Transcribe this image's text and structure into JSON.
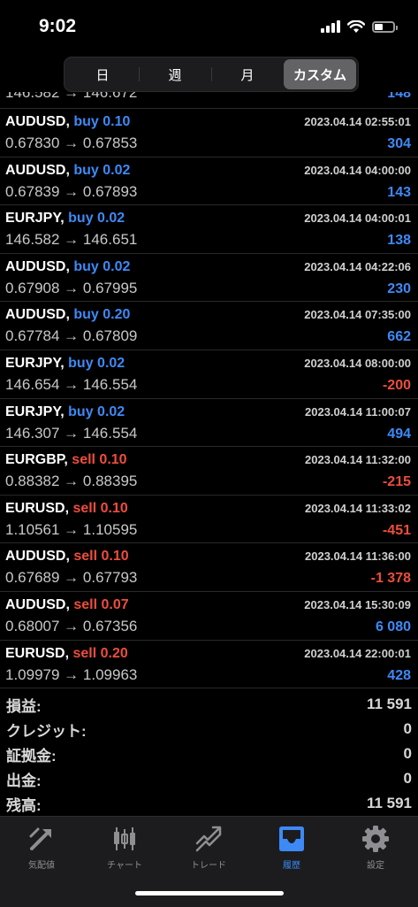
{
  "status_bar": {
    "time": "9:02"
  },
  "segments": [
    {
      "label": "日",
      "active": false
    },
    {
      "label": "週",
      "active": false
    },
    {
      "label": "月",
      "active": false
    },
    {
      "label": "カスタム",
      "active": true
    }
  ],
  "partial_row": {
    "prices": "146.582 → 146.672",
    "profit": "148"
  },
  "trades": [
    {
      "symbol": "AUDUSD,",
      "side": "buy 0.10",
      "type": "buy",
      "time": "2023.04.14 02:55:01",
      "prices": "0.67830 → 0.67853",
      "profit": "304",
      "sign": "pos"
    },
    {
      "symbol": "AUDUSD,",
      "side": "buy 0.02",
      "type": "buy",
      "time": "2023.04.14 04:00:00",
      "prices": "0.67839 → 0.67893",
      "profit": "143",
      "sign": "pos"
    },
    {
      "symbol": "EURJPY,",
      "side": "buy 0.02",
      "type": "buy",
      "time": "2023.04.14 04:00:01",
      "prices": "146.582 → 146.651",
      "profit": "138",
      "sign": "pos"
    },
    {
      "symbol": "AUDUSD,",
      "side": "buy 0.02",
      "type": "buy",
      "time": "2023.04.14 04:22:06",
      "prices": "0.67908 → 0.67995",
      "profit": "230",
      "sign": "pos"
    },
    {
      "symbol": "AUDUSD,",
      "side": "buy 0.20",
      "type": "buy",
      "time": "2023.04.14 07:35:00",
      "prices": "0.67784 → 0.67809",
      "profit": "662",
      "sign": "pos"
    },
    {
      "symbol": "EURJPY,",
      "side": "buy 0.02",
      "type": "buy",
      "time": "2023.04.14 08:00:00",
      "prices": "146.654 → 146.554",
      "profit": "-200",
      "sign": "neg"
    },
    {
      "symbol": "EURJPY,",
      "side": "buy 0.02",
      "type": "buy",
      "time": "2023.04.14 11:00:07",
      "prices": "146.307 → 146.554",
      "profit": "494",
      "sign": "pos"
    },
    {
      "symbol": "EURGBP,",
      "side": "sell 0.10",
      "type": "sell",
      "time": "2023.04.14 11:32:00",
      "prices": "0.88382 → 0.88395",
      "profit": "-215",
      "sign": "neg"
    },
    {
      "symbol": "EURUSD,",
      "side": "sell 0.10",
      "type": "sell",
      "time": "2023.04.14 11:33:02",
      "prices": "1.10561 → 1.10595",
      "profit": "-451",
      "sign": "neg"
    },
    {
      "symbol": "AUDUSD,",
      "side": "sell 0.10",
      "type": "sell",
      "time": "2023.04.14 11:36:00",
      "prices": "0.67689 → 0.67793",
      "profit": "-1 378",
      "sign": "neg"
    },
    {
      "symbol": "AUDUSD,",
      "side": "sell 0.07",
      "type": "sell",
      "time": "2023.04.14 15:30:09",
      "prices": "0.68007 → 0.67356",
      "profit": "6 080",
      "sign": "pos"
    },
    {
      "symbol": "EURUSD,",
      "side": "sell 0.20",
      "type": "sell",
      "time": "2023.04.14 22:00:01",
      "prices": "1.09979 → 1.09963",
      "profit": "428",
      "sign": "pos"
    }
  ],
  "summary": [
    {
      "label": "損益:",
      "value": "11 591"
    },
    {
      "label": "クレジット:",
      "value": "0"
    },
    {
      "label": "証拠金:",
      "value": "0"
    },
    {
      "label": "出金:",
      "value": "0"
    },
    {
      "label": "残高:",
      "value": "11 591"
    }
  ],
  "tabs": [
    {
      "label": "気配値",
      "icon": "quotes-icon",
      "active": false
    },
    {
      "label": "チャート",
      "icon": "chart-icon",
      "active": false
    },
    {
      "label": "トレード",
      "icon": "trade-icon",
      "active": false
    },
    {
      "label": "履歴",
      "icon": "history-icon",
      "active": true
    },
    {
      "label": "設定",
      "icon": "settings-icon",
      "active": false
    }
  ],
  "colors": {
    "buy": "#3d8af7",
    "sell": "#ef4d3c",
    "active_tab": "#3d8af7",
    "inactive_tab": "#8e8e93"
  }
}
